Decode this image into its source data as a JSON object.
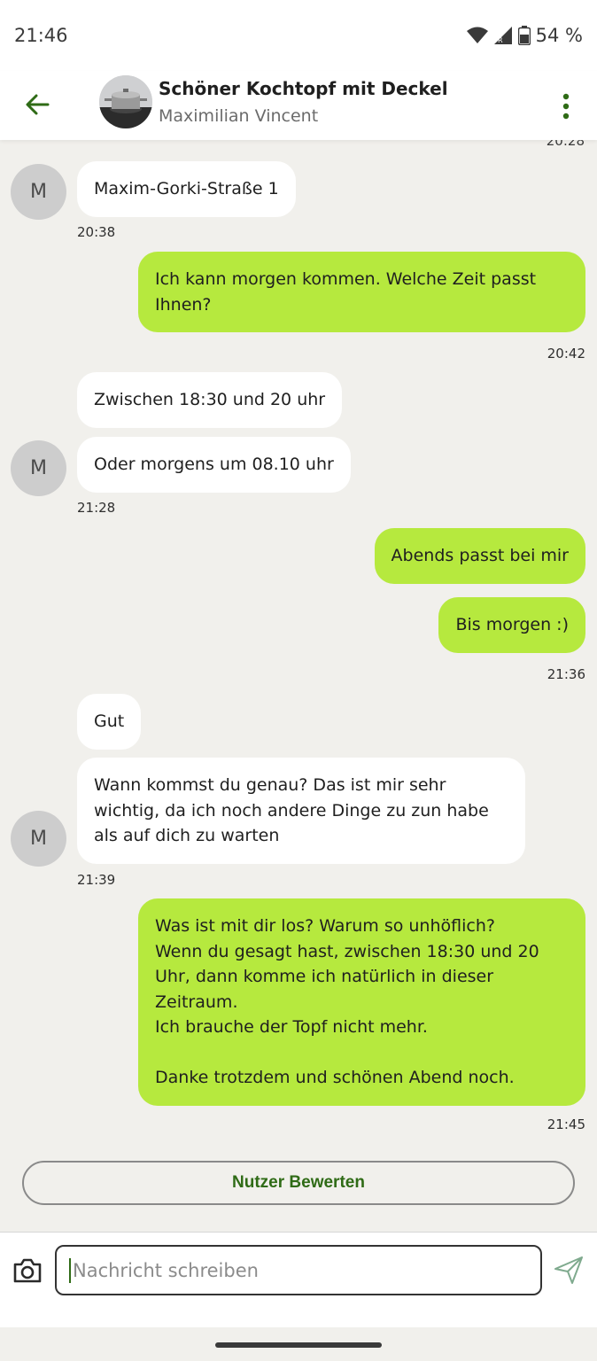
{
  "status_bar": {
    "time": "21:46",
    "battery": "54 %"
  },
  "header": {
    "title": "Schöner Kochtopf mit Deckel",
    "subtitle": "Maximilian Vincent"
  },
  "chat": {
    "cut_timestamp": "20:28",
    "avatar_letter": "M",
    "messages": [
      {
        "direction": "in",
        "text": "Maxim-Gorki-Straße 1"
      },
      {
        "direction": "out",
        "text": "Ich kann morgen kommen. Welche Zeit passt\nIhnen?"
      },
      {
        "direction": "in",
        "text": "Zwischen 18:30 und 20 uhr"
      },
      {
        "direction": "in",
        "text": "Oder morgens um 08.10 uhr"
      },
      {
        "direction": "out",
        "text": "Abends passt bei mir"
      },
      {
        "direction": "out",
        "text": "Bis morgen :)"
      },
      {
        "direction": "in",
        "text": "Gut"
      },
      {
        "direction": "in",
        "text": "Wann kommst du genau? Das ist mir sehr\nwichtig, da ich noch andere Dinge zu zun habe\nals auf dich zu warten"
      },
      {
        "direction": "out",
        "text": "Was ist mit dir los? Warum so unhöflich?\nWenn du gesagt hast, zwischen 18:30 und 20\nUhr, dann komme ich natürlich in dieser\nZeitraum.\nIch brauche der Topf nicht mehr.\n\nDanke trotzdem und schönen Abend noch."
      }
    ],
    "timestamps": [
      "20:38",
      "20:42",
      "21:28",
      "21:36",
      "21:39",
      "21:45"
    ]
  },
  "rate_button_label": "Nutzer Bewerten",
  "input": {
    "placeholder": "Nachricht schreiben"
  },
  "colors": {
    "accent": "#2f6b16",
    "outgoing_bubble": "#b6e93e",
    "incoming_bubble": "#ffffff",
    "background": "#f1f0ec"
  },
  "icons": [
    "back-arrow-icon",
    "more-vert-icon",
    "camera-icon",
    "send-icon",
    "wifi-icon",
    "signal-icon",
    "battery-icon"
  ]
}
